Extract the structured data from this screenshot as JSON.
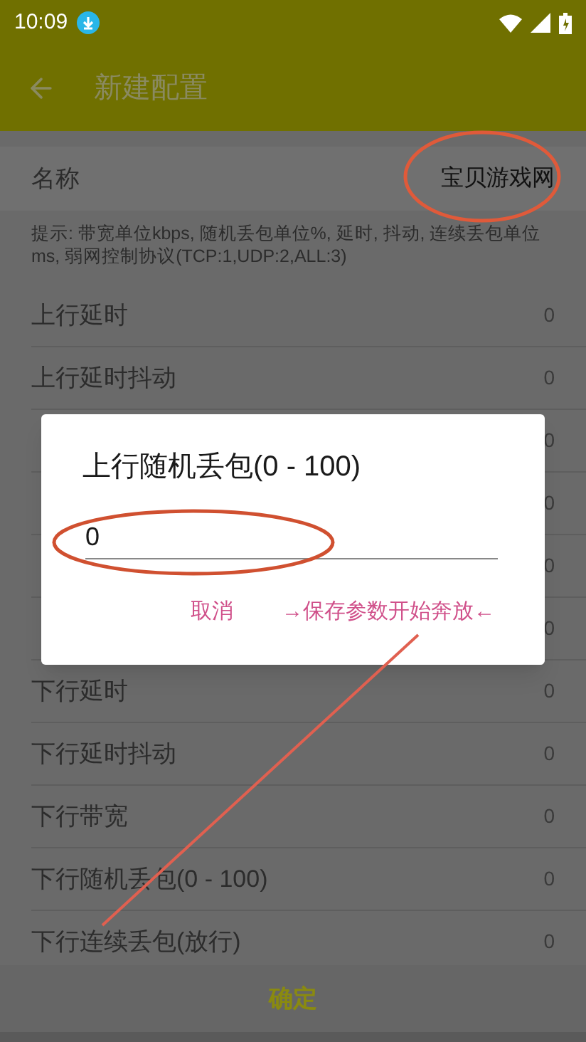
{
  "status_bar": {
    "time": "10:09"
  },
  "app_bar": {
    "title": "新建配置"
  },
  "name_row": {
    "label": "名称",
    "value": "宝贝游戏网"
  },
  "hint": "提示: 带宽单位kbps, 随机丢包单位%, 延时, 抖动, 连续丢包单位ms, 弱网控制协议(TCP:1,UDP:2,ALL:3)",
  "rows": [
    {
      "label": "上行延时",
      "value": "0"
    },
    {
      "label": "上行延时抖动",
      "value": "0"
    },
    {
      "value": "0"
    },
    {
      "value": "0"
    },
    {
      "value": "0"
    },
    {
      "value": "0"
    },
    {
      "label": "下行延时",
      "value": "0"
    },
    {
      "label": "下行延时抖动",
      "value": "0"
    },
    {
      "label": "下行带宽",
      "value": "0"
    },
    {
      "label": "下行随机丢包(0 - 100)",
      "value": "0"
    },
    {
      "label": "下行连续丢包(放行)",
      "value": "0"
    }
  ],
  "confirm_button": "确定",
  "dialog": {
    "title": "上行随机丢包(0 - 100)",
    "input_value": "0",
    "buttons": [
      "取消",
      "→保存参数开始奔放←"
    ]
  }
}
